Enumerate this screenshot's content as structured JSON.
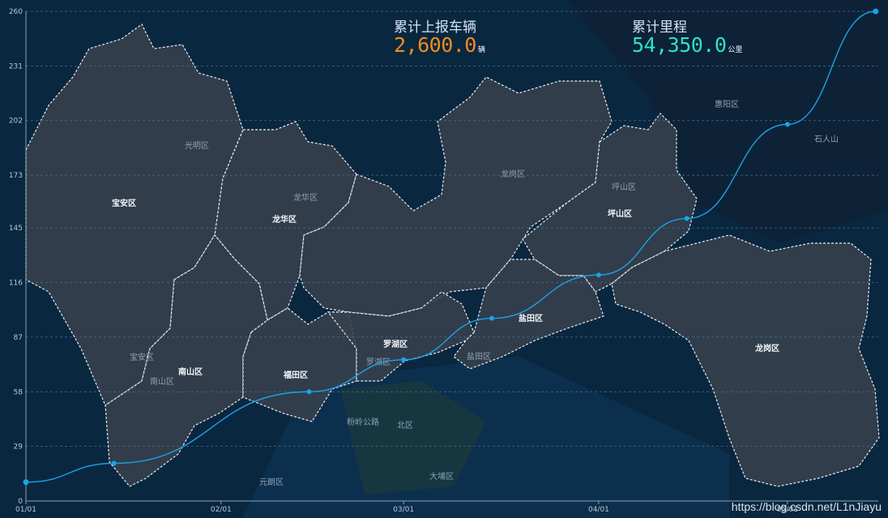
{
  "stats": {
    "vehicles": {
      "label": "累计上报车辆",
      "value": "2,600.0",
      "unit": "辆",
      "color": "#f38a1f"
    },
    "mileage": {
      "label": "累计里程",
      "value": "54,350.0",
      "unit": "公里",
      "color": "#2fe0c8"
    }
  },
  "map": {
    "districts": [
      "宝安区",
      "光明区",
      "龙华区",
      "龙岗区",
      "坪山区",
      "南山区",
      "福田区",
      "罗湖区",
      "盐田区",
      "龙岗区"
    ],
    "faint_labels": [
      "宝安区",
      "南山区",
      "罗湖区",
      "盐田区",
      "龙华区",
      "坪山区",
      "北区",
      "元朗区",
      "大埔区",
      "粉岭公路",
      "石人山",
      "惠阳区"
    ]
  },
  "chart_data": {
    "type": "line",
    "x": [
      "01/01",
      "01/15",
      "02/15",
      "03/01",
      "03/15",
      "04/01",
      "04/15",
      "05/01",
      "05/15"
    ],
    "values": [
      10,
      20,
      58,
      75,
      97,
      120,
      150,
      200,
      260
    ],
    "xticks": [
      "01/01",
      "02/01",
      "03/01",
      "04/01",
      "05/01"
    ],
    "yticks": [
      0,
      29,
      58,
      87,
      116,
      145,
      173,
      202,
      231,
      260
    ],
    "ylim": [
      0,
      260
    ],
    "grid": true,
    "line_color": "#1aa3e8"
  },
  "watermark": "https://blog.csdn.net/L1nJiayu"
}
